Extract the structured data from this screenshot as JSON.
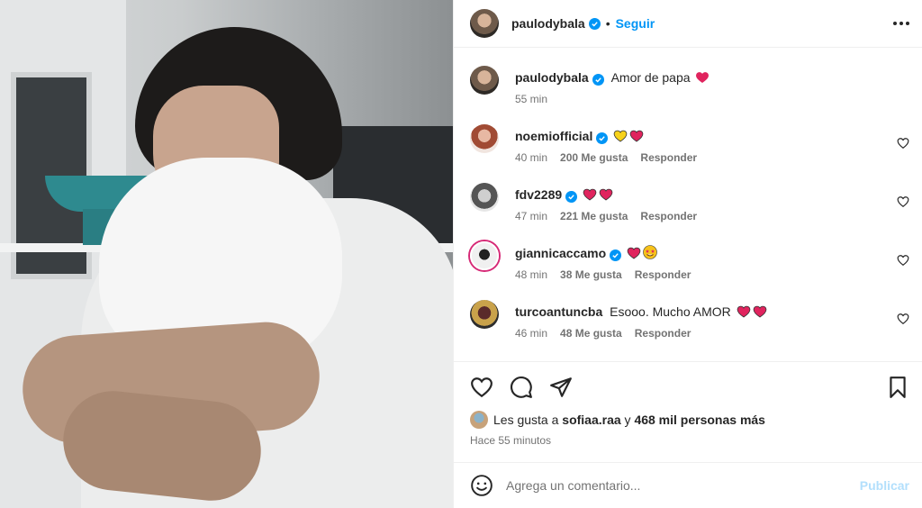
{
  "post": {
    "author": "paulodybala",
    "follow_label": "Seguir",
    "separator": "•",
    "caption_text": "Amor de papa",
    "caption_time": "55 min"
  },
  "comments": [
    {
      "user": "noemiofficial",
      "text": "",
      "time": "40 min",
      "likes": "200 Me gusta",
      "reply": "Responder"
    },
    {
      "user": "fdv2289",
      "text": "",
      "time": "47 min",
      "likes": "221 Me gusta",
      "reply": "Responder"
    },
    {
      "user": "giannicaccamo",
      "text": "",
      "time": "48 min",
      "likes": "38 Me gusta",
      "reply": "Responder"
    },
    {
      "user": "turcoantuncba",
      "text": "Esooo. Mucho AMOR",
      "time": "46 min",
      "likes": "48 Me gusta",
      "reply": "Responder"
    }
  ],
  "likes_summary": {
    "prefix": "Les gusta a",
    "user": "sofiaa.raa",
    "joiner": "y",
    "others": "468 mil personas más"
  },
  "posted_ago": "Hace 55 minutos",
  "composer": {
    "placeholder": "Agrega un comentario...",
    "publish_label": "Publicar"
  },
  "colors": {
    "accent": "#0095f6",
    "publish_disabled": "#b2dffc",
    "heart_red": "#e0245e",
    "meta_gray": "#737373"
  },
  "icons": [
    "verified-badge-icon",
    "more-options-icon",
    "heart-icon",
    "comment-icon",
    "share-icon",
    "bookmark-icon",
    "emoji-icon",
    "like-heart-icon"
  ]
}
